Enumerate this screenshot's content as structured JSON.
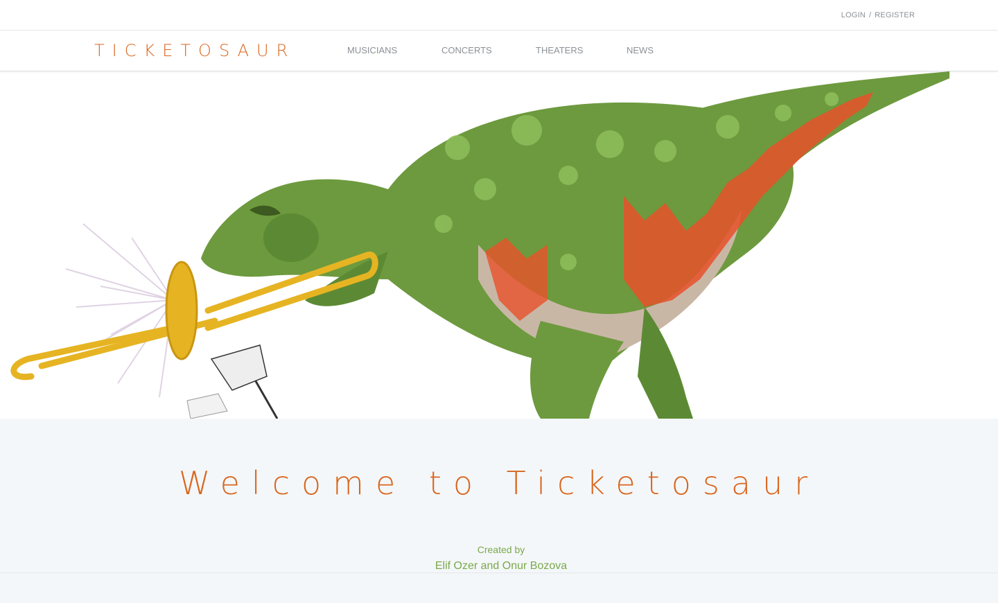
{
  "auth": {
    "login_label": "LOGIN",
    "separator": "/",
    "register_label": "REGISTER"
  },
  "navbar": {
    "brand": "TICKETOSAUR",
    "items": [
      {
        "label": "MUSICIANS"
      },
      {
        "label": "CONCERTS"
      },
      {
        "label": "THEATERS"
      },
      {
        "label": "NEWS"
      }
    ]
  },
  "hero": {
    "image_subject": "dinosaur-playing-trombone-illustration",
    "colors": {
      "skin": "#6d9a3e",
      "skin_dark": "#4f7a2a",
      "spikes": "#e8512a",
      "belly": "#c9b7a6",
      "brass": "#e6b423"
    }
  },
  "main": {
    "title": "Welcome to Ticketosaur",
    "credit_label": "Created by",
    "credit_names": "Elif Ozer and Onur Bozova"
  },
  "colors": {
    "brand": "#d9661e",
    "nav_text": "#8c9196",
    "credit": "#7aa84a",
    "page_bg": "#f4f7f9"
  }
}
